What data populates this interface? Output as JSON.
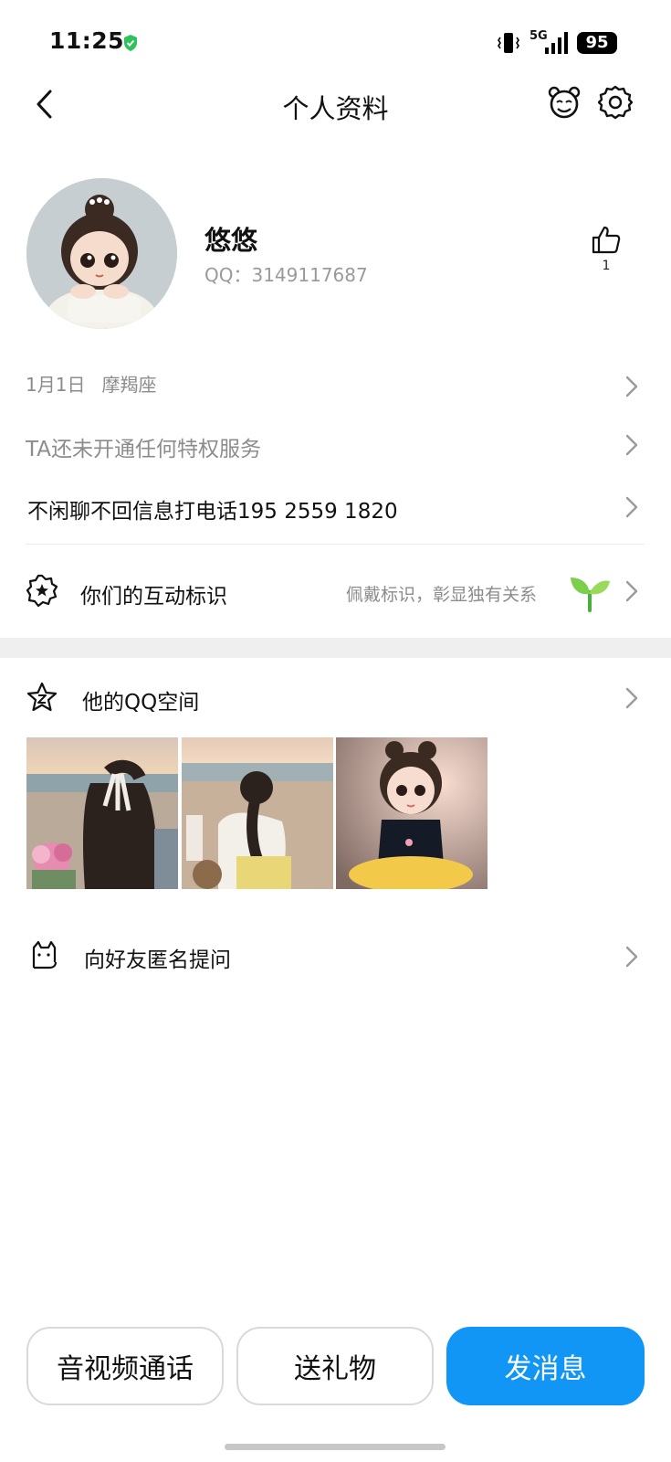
{
  "status_bar": {
    "time": "11:25",
    "network": "5G",
    "battery": "95",
    "icons": [
      "shield-check-icon",
      "vibrate-icon",
      "signal-icon",
      "battery-icon"
    ]
  },
  "header": {
    "title": "个人资料",
    "icons": [
      "back-icon",
      "bear-icon",
      "gear-icon"
    ]
  },
  "profile": {
    "nickname": "悠悠",
    "qq": "QQ：3149117687",
    "likes": "1"
  },
  "info": {
    "birthday": "1月1日",
    "zodiac": "摩羯座",
    "privilege": "TA还未开通任何特权服务",
    "signature": "不闲聊不回信息打电话195 2559 1820"
  },
  "interaction_badge": {
    "label": "你们的互动标识",
    "hint": "佩戴标识，彰显独有关系"
  },
  "qzone": {
    "label": "他的QQ空间",
    "photo_count": 3
  },
  "anonymous_question": {
    "label": "向好友匿名提问"
  },
  "actions": {
    "call": "音视频通话",
    "gift": "送礼物",
    "message": "发消息"
  },
  "colors": {
    "primary": "#1296f5",
    "gray_text": "#8c8c8c",
    "band": "#efefef"
  }
}
